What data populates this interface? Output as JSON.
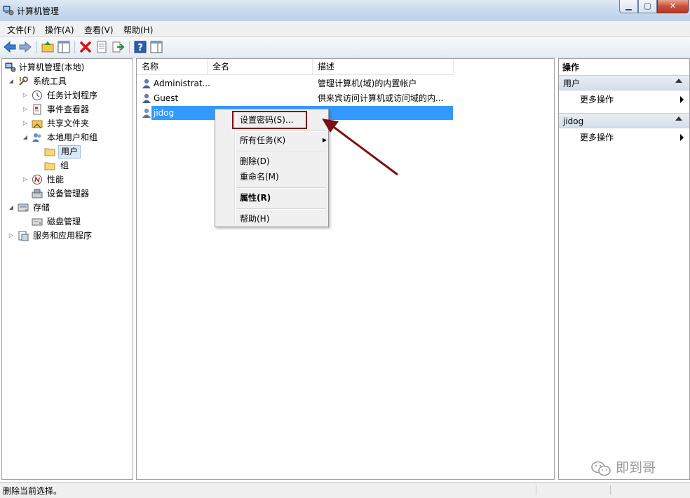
{
  "window": {
    "title": "计算机管理"
  },
  "menubar": [
    "文件(F)",
    "操作(A)",
    "查看(V)",
    "帮助(H)"
  ],
  "toolbar": {
    "icons": [
      "back-icon",
      "forward-icon",
      "up-folder-icon",
      "show-tree-icon",
      "delete-icon",
      "properties-icon",
      "export-icon",
      "help-icon",
      "show-action-pane-icon"
    ]
  },
  "tree": {
    "root": "计算机管理(本地)",
    "system_tools": "系统工具",
    "task_scheduler": "任务计划程序",
    "event_viewer": "事件查看器",
    "shared_folders": "共享文件夹",
    "local_users": "本地用户和组",
    "users": "用户",
    "groups": "组",
    "performance": "性能",
    "device_manager": "设备管理器",
    "storage": "存储",
    "disk_management": "磁盘管理",
    "services": "服务和应用程序"
  },
  "list": {
    "columns": [
      "名称",
      "全名",
      "描述"
    ],
    "rows": [
      {
        "name": "Administrat...",
        "fullname": "",
        "description": "管理计算机(域)的内置帐户"
      },
      {
        "name": "Guest",
        "fullname": "",
        "description": "供来宾访问计算机或访问域的内..."
      },
      {
        "name": "jidog",
        "fullname": "",
        "description": ""
      }
    ]
  },
  "context_menu": {
    "set_password": "设置密码(S)...",
    "all_tasks": "所有任务(K)",
    "delete": "删除(D)",
    "rename": "重命名(M)",
    "properties": "属性(R)",
    "help": "帮助(H)"
  },
  "actions": {
    "title": "操作",
    "section1": "用户",
    "more1": "更多操作",
    "section2": "jidog",
    "more2": "更多操作"
  },
  "status": {
    "text": "删除当前选择。"
  },
  "watermark": {
    "text": "即到哥"
  },
  "colors": {
    "selection": "#3399ff",
    "annotation": "#7a0f14"
  }
}
